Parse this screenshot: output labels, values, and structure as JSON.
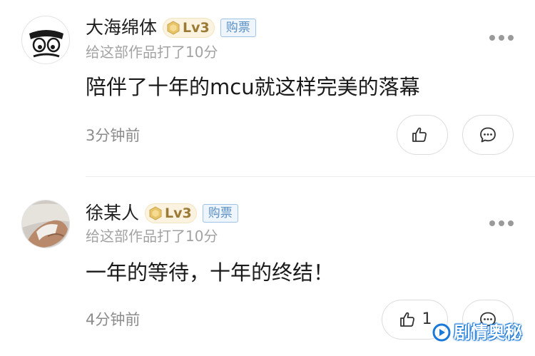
{
  "comments": [
    {
      "username": "大海绵体",
      "level": "Lv3",
      "buy_tag": "购票",
      "rating_text": "给这部作品打了10分",
      "content": "陪伴了十年的mcu就这样完美的落幕",
      "time": "3分钟前",
      "like_count": "",
      "avatar": "cartoon-face"
    },
    {
      "username": "徐某人",
      "level": "Lv3",
      "buy_tag": "购票",
      "rating_text": "给这部作品打了10分",
      "content": "一年的等待，十年的终结！",
      "time": "4分钟前",
      "like_count": "1",
      "avatar": "photo-hand"
    }
  ],
  "watermark": {
    "text": "剧情奥秘"
  },
  "icons": {
    "like": "thumbs-up-icon",
    "reply": "comment-bubble-icon",
    "more": "more-dots-icon",
    "level": "hexagon-level-icon"
  },
  "colors": {
    "username": "#1f1f1f",
    "muted": "#a3a3a3",
    "level_badge_text": "#9a7a35",
    "buy_tag": "#5a8fc4",
    "watermark": "#1a79d8"
  }
}
